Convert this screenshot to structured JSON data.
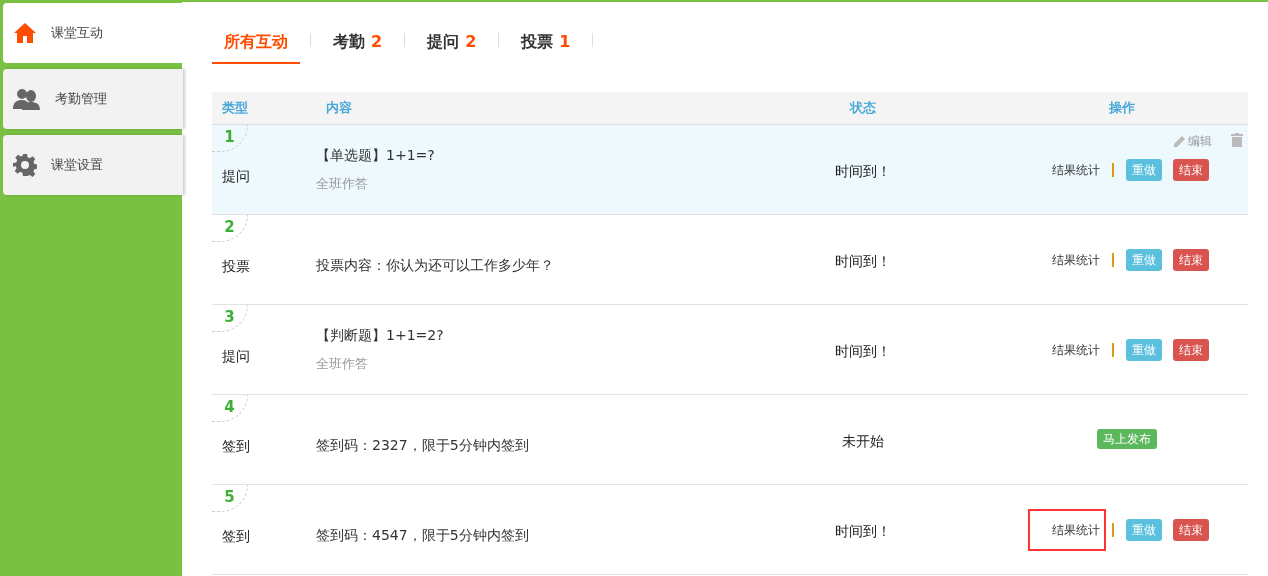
{
  "sidebar": {
    "items": [
      {
        "label": "课堂互动",
        "selected": true
      },
      {
        "label": "考勤管理",
        "selected": false
      },
      {
        "label": "课堂设置",
        "selected": false
      }
    ]
  },
  "tabs": [
    {
      "label": "所有互动",
      "selected": true
    },
    {
      "label": "考勤",
      "count": "2",
      "selected": false
    },
    {
      "label": "提问",
      "count": "2",
      "selected": false
    },
    {
      "label": "投票",
      "count": "1",
      "selected": false
    }
  ],
  "table": {
    "columns": [
      "类型",
      "内容",
      "状态",
      "操作"
    ],
    "rows": [
      {
        "number": "1",
        "type": "提问",
        "content": "【单选题】1+1=?",
        "note": "全班作答",
        "status": "时间到！",
        "selected": true,
        "edit": "编辑",
        "actions": {
          "kind": "results",
          "link": "结果统计",
          "redo": "重做",
          "end": "结束"
        },
        "highlighted": false
      },
      {
        "number": "2",
        "type": "投票",
        "content": "投票内容：你认为还可以工作多少年？",
        "status": "时间到！",
        "selected": false,
        "actions": {
          "kind": "results",
          "link": "结果统计",
          "redo": "重做",
          "end": "结束"
        },
        "highlighted": false
      },
      {
        "number": "3",
        "type": "提问",
        "content": "【判断题】1+1=2?",
        "note": "全班作答",
        "status": "时间到！",
        "selected": false,
        "actions": {
          "kind": "results",
          "link": "结果统计",
          "redo": "重做",
          "end": "结束"
        },
        "highlighted": false
      },
      {
        "number": "4",
        "type": "签到",
        "content": "签到码：2327，限于5分钟内签到",
        "status": "未开始",
        "selected": false,
        "actions": {
          "kind": "publish",
          "publish": "马上发布"
        },
        "highlighted": false
      },
      {
        "number": "5",
        "type": "签到",
        "content": "签到码：4547，限于5分钟内签到",
        "status": "时间到！",
        "selected": false,
        "actions": {
          "kind": "results",
          "link": "结果统计",
          "redo": "重做",
          "end": "结束"
        },
        "highlighted": true
      }
    ]
  }
}
